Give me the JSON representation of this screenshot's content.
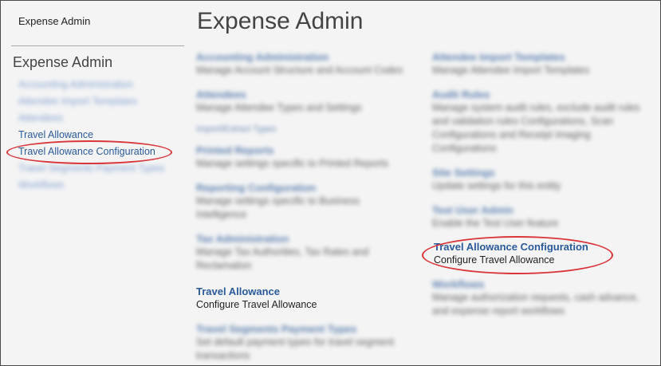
{
  "sidebar": {
    "top_title": "Expense Admin",
    "heading": "Expense Admin",
    "items": [
      {
        "label": "Accounting Administration"
      },
      {
        "label": "Attendee Import Templates"
      },
      {
        "label": "Attendees"
      },
      {
        "label": "Travel Allowance"
      },
      {
        "label": "Travel Allowance Configuration"
      },
      {
        "label": "Travel Segments Payment Types"
      },
      {
        "label": "Workflows"
      }
    ]
  },
  "main": {
    "title": "Expense Admin",
    "left_items": [
      {
        "title": "Accounting Administration",
        "desc": "Manage Account Structure and Account Codes"
      },
      {
        "title": "Attendees",
        "desc": "Manage Attendee Types and Settings"
      },
      {
        "title": "Import/Extract Types",
        "desc": ""
      },
      {
        "title": "Printed Reports",
        "desc": "Manage settings specific to Printed Reports"
      },
      {
        "title": "Reporting Configuration",
        "desc": "Manage settings specific to Business Intelligence"
      },
      {
        "title": "Tax Administration",
        "desc": "Manage Tax Authorities, Tax Rates and Reclamation"
      },
      {
        "title": "Travel Allowance",
        "desc": "Configure Travel Allowance"
      },
      {
        "title": "Travel Segments Payment Types",
        "desc": "Set default payment types for travel segment transactions"
      }
    ],
    "right_items": [
      {
        "title": "Attendee Import Templates",
        "desc": "Manage Attendee Import Templates"
      },
      {
        "title": "Audit Rules",
        "desc": "Manage system audit rules, exclude audit rules and validation rules Configurations, Scan Configurations and Receipt Imaging Configurations"
      },
      {
        "title": "Site Settings",
        "desc": "Update settings for this entity"
      },
      {
        "title": "Test User Admin",
        "desc": "Enable the Test User feature"
      },
      {
        "title": "Travel Allowance Configuration",
        "desc": "Configure Travel Allowance"
      },
      {
        "title": "Workflows",
        "desc": "Manage authorization requests, cash advance, and expense report workflows"
      }
    ]
  },
  "colors": {
    "link": "#2a5a9a",
    "annotation": "#d9363b"
  }
}
